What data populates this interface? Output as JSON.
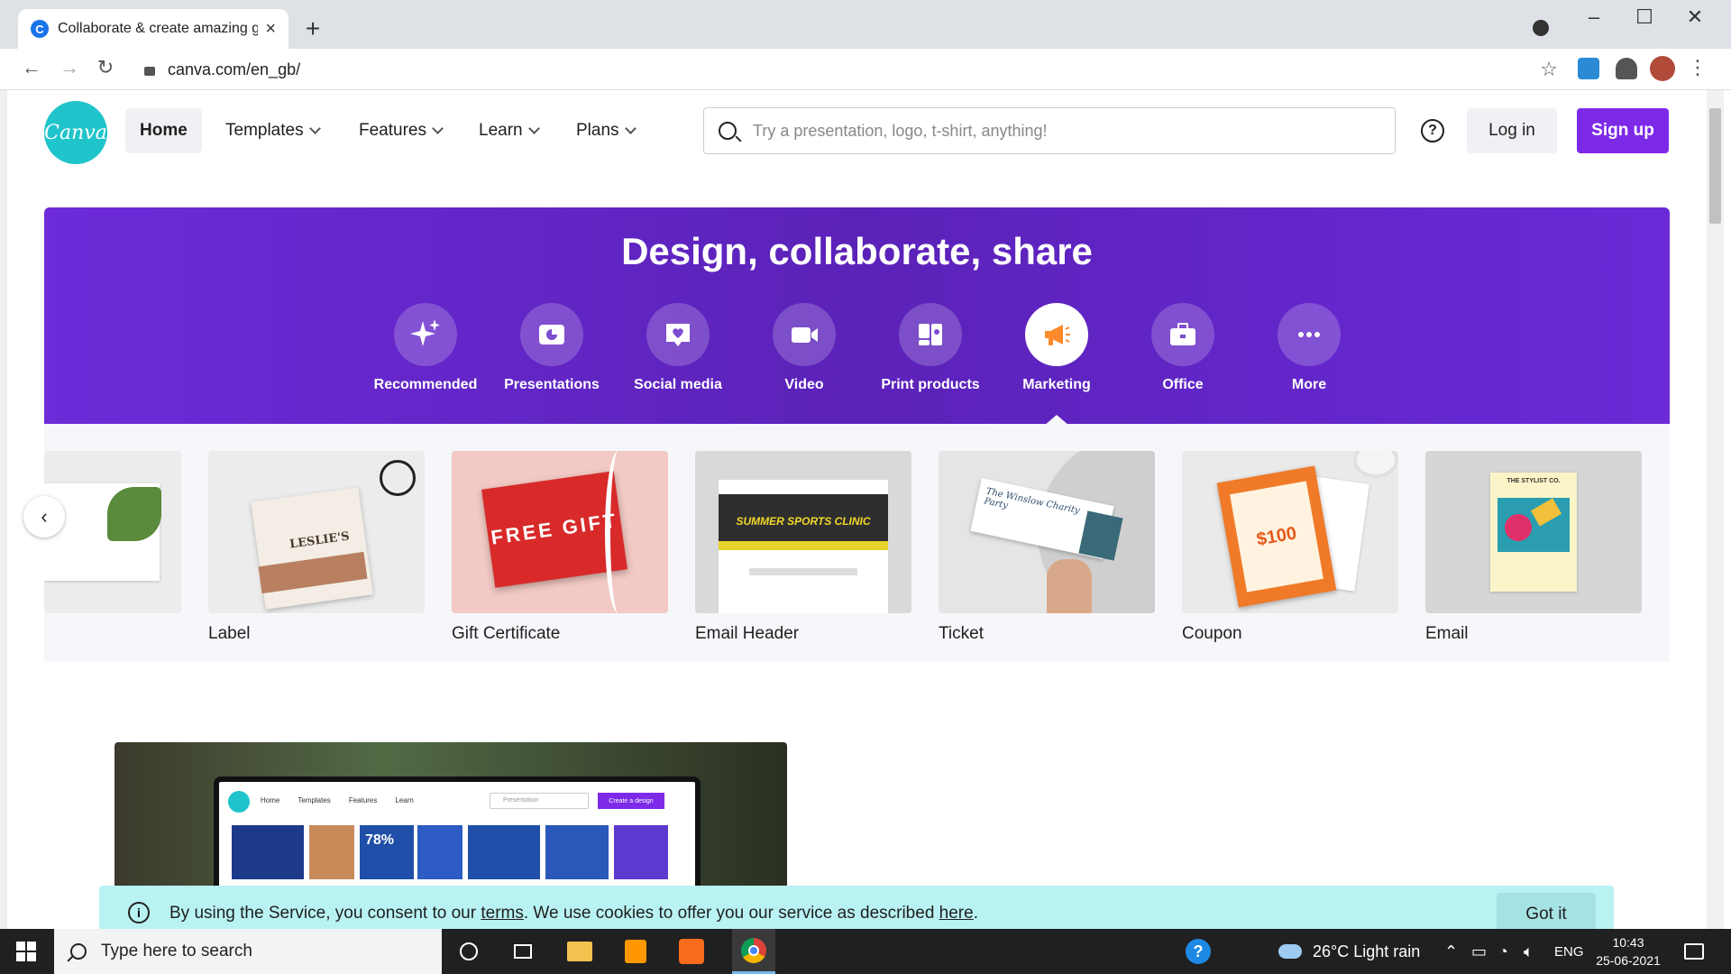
{
  "browser": {
    "tab_title": "Collaborate & create amazing gr",
    "tab_favicon": "C",
    "url": "canva.com/en_gb/"
  },
  "header": {
    "logo_text": "Canva",
    "nav": [
      {
        "label": "Home",
        "has_chevron": false
      },
      {
        "label": "Templates",
        "has_chevron": true
      },
      {
        "label": "Features",
        "has_chevron": true
      },
      {
        "label": "Learn",
        "has_chevron": true
      },
      {
        "label": "Plans",
        "has_chevron": true
      }
    ],
    "search_placeholder": "Try a presentation, logo, t-shirt, anything!",
    "help_icon": "?",
    "login_label": "Log in",
    "signup_label": "Sign up"
  },
  "hero": {
    "title": "Design, collaborate, share",
    "categories": [
      {
        "label": "Recommended",
        "icon": "sparkle-icon"
      },
      {
        "label": "Presentations",
        "icon": "presentation-icon"
      },
      {
        "label": "Social media",
        "icon": "heart-chat-icon"
      },
      {
        "label": "Video",
        "icon": "video-camera-icon"
      },
      {
        "label": "Print products",
        "icon": "print-icon"
      },
      {
        "label": "Marketing",
        "icon": "megaphone-icon"
      },
      {
        "label": "Office",
        "icon": "briefcase-icon"
      },
      {
        "label": "More",
        "icon": "more-dots-icon"
      }
    ],
    "active_category": "Marketing"
  },
  "cards": [
    {
      "label": "Label"
    },
    {
      "label": "Gift Certificate",
      "image_text": "FREE GIFT"
    },
    {
      "label": "Email Header",
      "image_text": "SUMMER SPORTS CLINIC"
    },
    {
      "label": "Ticket",
      "image_text": "The Winslow Charity Party"
    },
    {
      "label": "Coupon",
      "image_text": "$100"
    },
    {
      "label": "Email",
      "image_text": "THE STYLIST CO."
    }
  ],
  "partial_card_label": "",
  "carousel_prev_icon": "‹",
  "laptop_mock": {
    "nav": [
      "Home",
      "Templates",
      "Features",
      "Learn"
    ],
    "search_placeholder": "Presentation",
    "cta": "Create a design",
    "stat": "78%"
  },
  "cookie": {
    "text_before": "By using the Service, you consent to our ",
    "terms_link": "terms",
    "text_middle": ". We use cookies to offer you our service as described ",
    "here_link": "here",
    "text_after": ".",
    "got_it_label": "Got it"
  },
  "taskbar": {
    "search_placeholder": "Type here to search",
    "weather": "26°C  Light rain",
    "language": "ENG",
    "time": "10:43",
    "date": "25-06-2021"
  },
  "colors": {
    "brand_purple": "#7d2ae8",
    "logo_teal": "#20c4cb",
    "cookie_bg": "#b9f2f3"
  }
}
